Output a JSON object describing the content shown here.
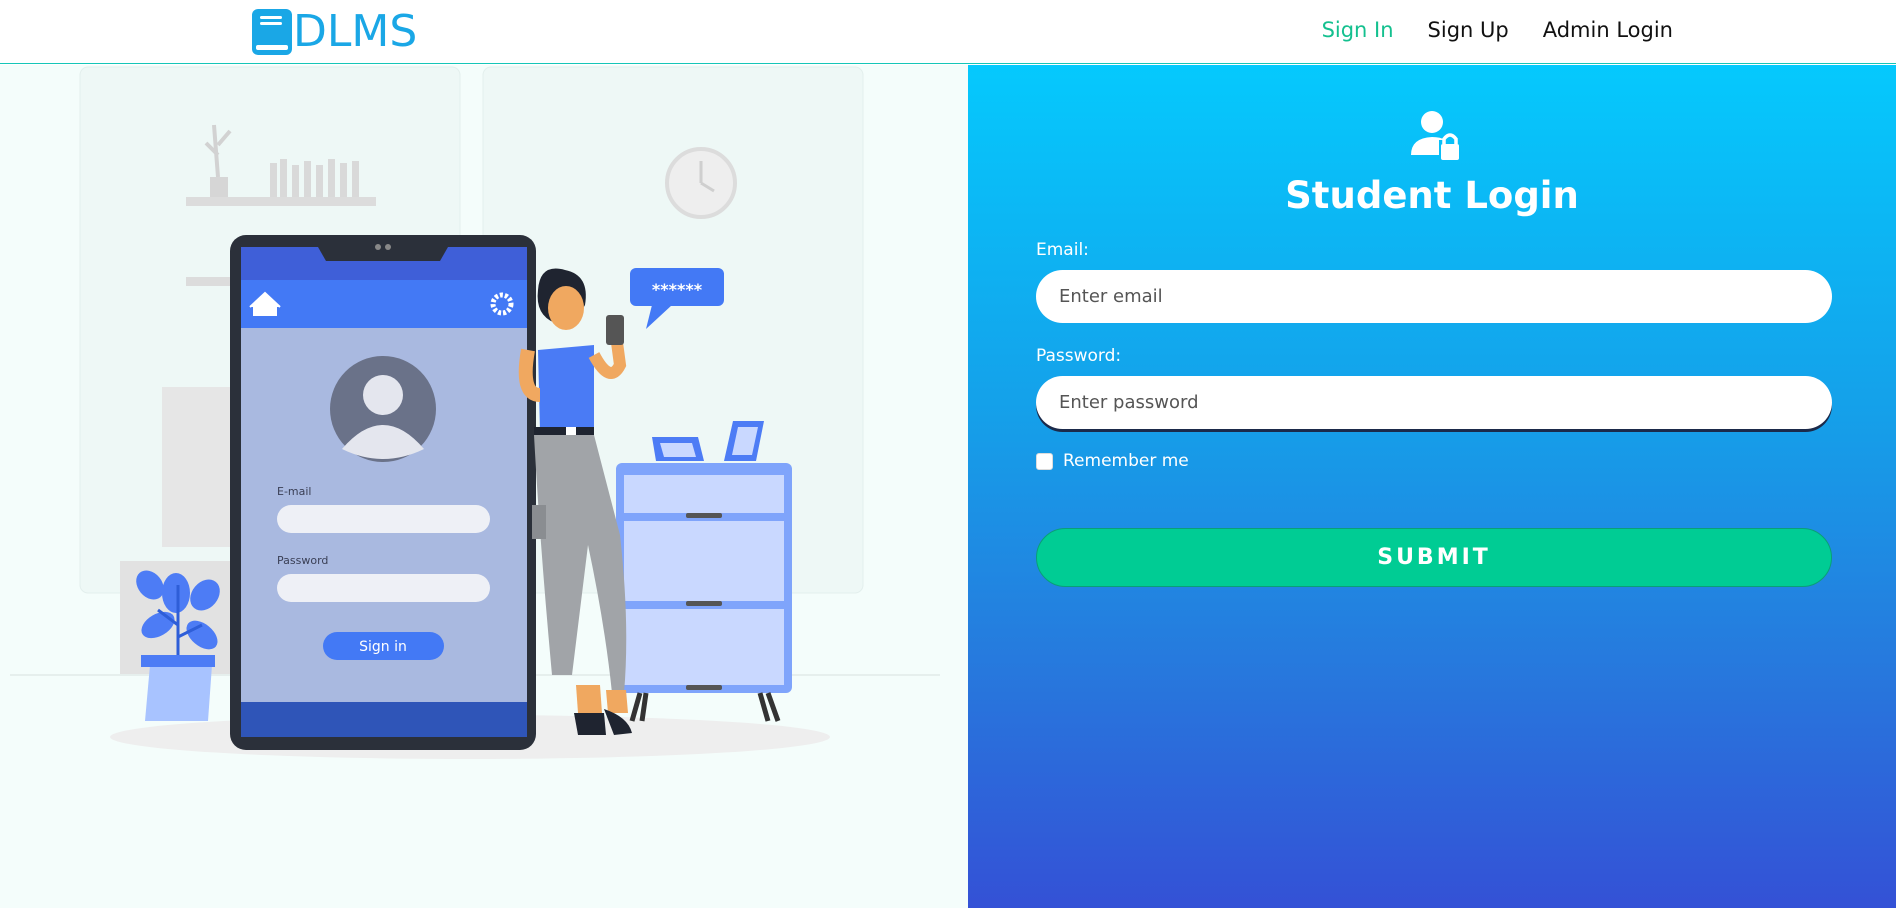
{
  "brand": {
    "name": "DLMS",
    "icon": "book-icon",
    "color": "#1aa7e6"
  },
  "nav": {
    "items": [
      {
        "label": "Sign In",
        "active": true
      },
      {
        "label": "Sign Up",
        "active": false
      },
      {
        "label": "Admin Login",
        "active": false
      }
    ],
    "active_color": "#14c08f"
  },
  "illustration": {
    "speech_bubble": "******",
    "phone_email_label": "E-mail",
    "phone_password_label": "Password",
    "phone_button": "Sign in"
  },
  "login": {
    "icon": "user-lock-icon",
    "title": "Student Login",
    "email_label": "Email:",
    "email_placeholder": "Enter email",
    "email_value": "",
    "password_label": "Password:",
    "password_placeholder": "Enter password",
    "password_value": "",
    "remember_label": "Remember me",
    "remember_checked": false,
    "submit_label": "SUBMIT",
    "submit_color": "#00cc94"
  }
}
